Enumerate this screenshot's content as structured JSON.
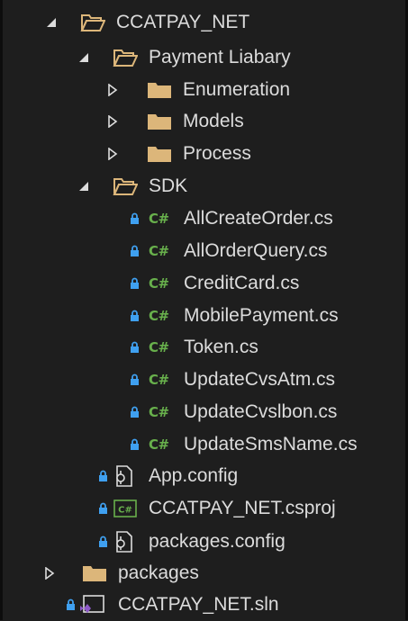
{
  "colors": {
    "background": "#1e1e1e",
    "text": "#dcdcdc",
    "folder": "#dcb67a",
    "csharp": "#68b04c",
    "lock": "#3fa0f0",
    "solution": "#8e5ac8"
  },
  "tree": {
    "project": "CCATPAY_NET",
    "payment_folder": "Payment Liabary",
    "enumeration_folder": "Enumeration",
    "models_folder": "Models",
    "process_folder": "Process",
    "sdk_folder": "SDK",
    "cs_badge": "C#",
    "sdk_files": [
      "AllCreateOrder.cs",
      "AllOrderQuery.cs",
      "CreditCard.cs",
      "MobilePayment.cs",
      "Token.cs",
      "UpdateCvsAtm.cs",
      "UpdateCvslbon.cs",
      "UpdateSmsName.cs"
    ],
    "app_config": "App.config",
    "csproj_file": "CCATPAY_NET.csproj",
    "packages_config": "packages.config",
    "packages_folder": "packages",
    "solution_file": "CCATPAY_NET.sln"
  }
}
